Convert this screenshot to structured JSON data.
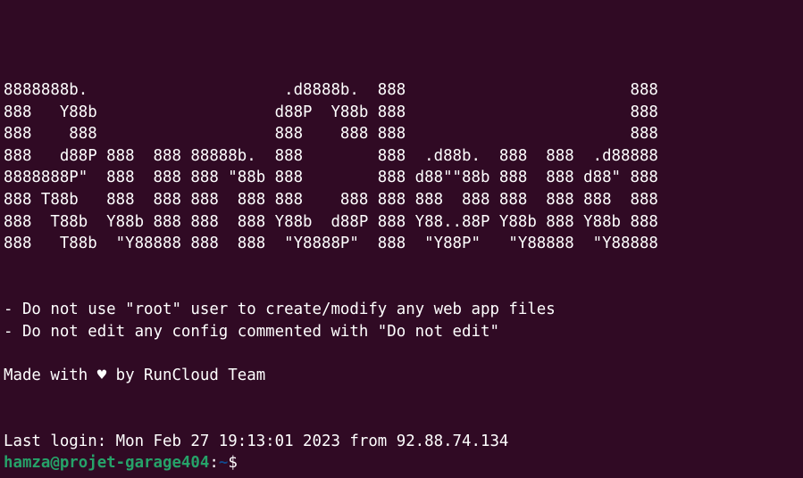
{
  "terminal": {
    "banner": [
      "8888888b.                     .d8888b.  888                        888",
      "888   Y88b                   d88P  Y88b 888                        888",
      "888    888                   888    888 888                        888",
      "888   d88P 888  888 88888b.  888        888  .d88b.  888  888  .d88888",
      "8888888P\"  888  888 888 \"88b 888        888 d88\"\"88b 888  888 d88\" 888",
      "888 T88b   888  888 888  888 888    888 888 888  888 888  888 888  888",
      "888  T88b  Y88b 888 888  888 Y88b  d88P 888 Y88..88P Y88b 888 Y88b 888",
      "888   T88b  \"Y88888 888  888  \"Y8888P\"  888  \"Y88P\"   \"Y88888  \"Y88888"
    ],
    "notice_1": "- Do not use \"root\" user to create/modify any web app files",
    "notice_2": "- Do not edit any config commented with \"Do not edit\"",
    "credit": "Made with ♥ by RunCloud Team",
    "last_login": "Last login: Mon Feb 27 19:13:01 2023 from 92.88.74.134",
    "prompt": {
      "user_host": "hamza@projet-garage404",
      "separator": ":",
      "path": "~",
      "symbol": "$"
    }
  },
  "colors": {
    "background": "#300a24",
    "foreground": "#ffffff",
    "prompt_user": "#26a269",
    "prompt_path": "#12488b"
  }
}
